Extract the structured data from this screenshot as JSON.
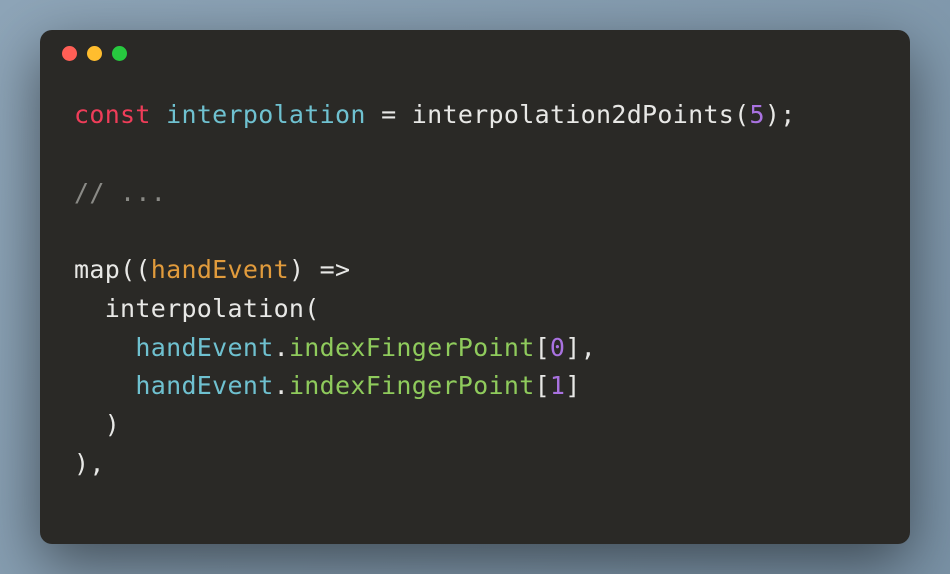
{
  "traffic_lights": {
    "red": "#ff5f56",
    "yellow": "#ffbd2e",
    "green": "#27c93f"
  },
  "code": {
    "l1": {
      "kw": "const",
      "sp1": " ",
      "decl": "interpolation",
      "sp2": " ",
      "eq": "=",
      "sp3": " ",
      "fn": "interpolation2dPoints",
      "op": "(",
      "num": "5",
      "cp_sc": ");"
    },
    "l2_blank": "",
    "l3": {
      "comment": "// ..."
    },
    "l4_blank": "",
    "l5": {
      "fn": "map",
      "op": "((",
      "param": "handEvent",
      "cp_arrow": ") =>"
    },
    "l6": {
      "indent": "  ",
      "fn": "interpolation",
      "op": "("
    },
    "l7": {
      "indent": "    ",
      "obj": "handEvent",
      "dot": ".",
      "prop": "indexFingerPoint",
      "ob": "[",
      "num": "0",
      "cb_c": "],"
    },
    "l8": {
      "indent": "    ",
      "obj": "handEvent",
      "dot": ".",
      "prop": "indexFingerPoint",
      "ob": "[",
      "num": "1",
      "cb": "]"
    },
    "l9": {
      "indent": "  ",
      "cp": ")"
    },
    "l10": {
      "cp_c": "),"
    }
  }
}
